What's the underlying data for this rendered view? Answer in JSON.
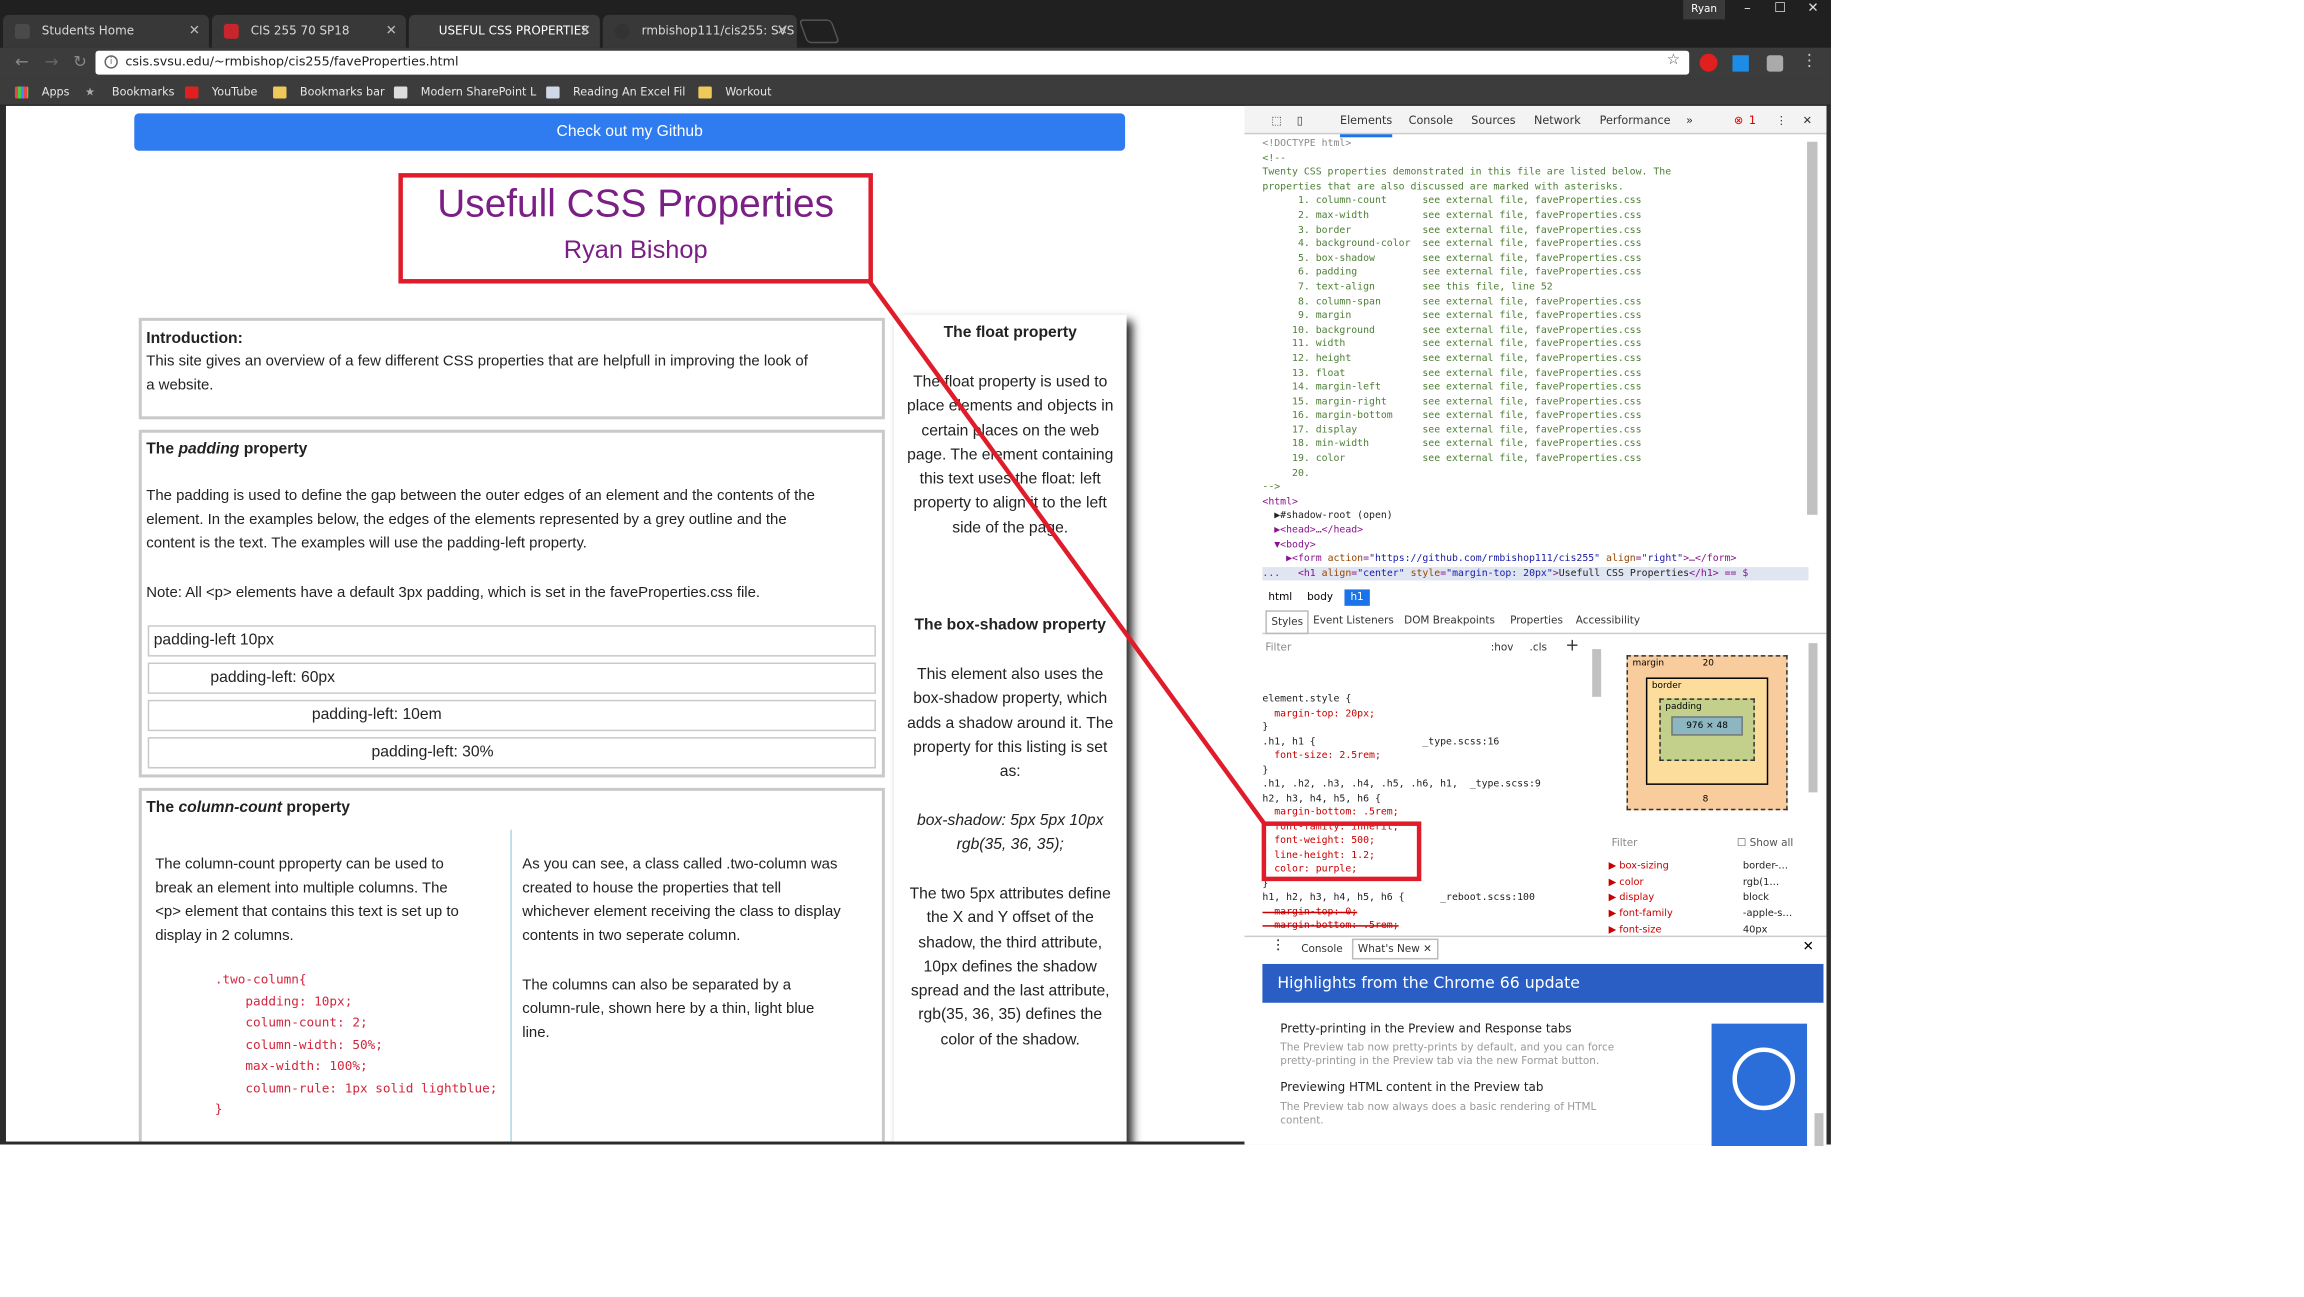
{
  "tabs": [
    {
      "label": "Students Home",
      "color": "#4a4a4a"
    },
    {
      "label": "CIS 255 70 SP18",
      "color": "#c9252c"
    },
    {
      "label": "USEFUL CSS PROPERTIES",
      "color": "#6f6f6f"
    },
    {
      "label": "rmbishop111/cis255: SVS",
      "color": "#333333"
    }
  ],
  "profile": "Ryan",
  "address": "csis.svsu.edu/~rmbishop/cis255/faveProperties.html",
  "bookmarks": [
    "Apps",
    "Bookmarks",
    "YouTube",
    "Bookmarks bar",
    "Modern SharePoint L",
    "Reading An Excel Fil",
    "Workout"
  ],
  "page": {
    "git_button": "Check out my Github",
    "title": "Usefull CSS Properties",
    "author": "Ryan Bishop",
    "intro_heading": "Introduction:",
    "intro_text_1": "This site gives an overview of a few different CSS properties that are helpfull in improving the look of",
    "intro_text_2": "a website.",
    "padding_heading_pre": "The ",
    "padding_heading_em": "padding",
    "padding_heading_post": " property",
    "padding_text_1": "The padding is used to define the gap between the outer edges of an element and the contents of the",
    "padding_text_2": "element. In the examples below, the edges of the elements represented by a grey outline and the",
    "padding_text_3": "content is the text. The examples will use the padding-left property.",
    "padding_note": "Note: All <p> elements have a default 3px padding, which is set in the faveProperties.css file.",
    "padding_examples": [
      "padding-left 10px",
      "padding-left: 60px",
      "padding-left: 10em",
      "padding-left: 30%"
    ],
    "column_heading_pre": "The ",
    "column_heading_em": "column-count",
    "column_heading_post": " property",
    "column_left": [
      "The column-count pproperty can be used to",
      "break an element into multiple columns. The",
      "<p> element that contains this text is set up to",
      "display in 2 columns."
    ],
    "column_code": [
      ".two-column{",
      "    padding: 10px;",
      "    column-count: 2;",
      "    column-width: 50%;",
      "    max-width: 100%;",
      "    column-rule: 1px solid lightblue;",
      "}"
    ],
    "column_right_1": [
      "As you can see, a class called .two-column was",
      "created to house the properties that tell",
      "whichever element receiving the class to display",
      "contents in two seperate column."
    ],
    "column_right_2": [
      "The columns can also be separated by a",
      "column-rule, shown here by a thin, light blue",
      "line."
    ],
    "float_heading": "The float property",
    "float_text": [
      "The float property is used to",
      "place elements and objects in",
      "certain places on the web",
      "page. The element containing",
      "this text uses the float: left",
      "property to align it to the left",
      "side of the page."
    ],
    "shadow_heading": "The box-shadow property",
    "shadow_text": [
      "This element also uses the",
      "box-shadow property, which",
      "adds a shadow around it. The",
      "property for this listing is set",
      "as:"
    ],
    "shadow_code": [
      "box-shadow: 5px 5px 10px",
      "rgb(35, 36, 35);"
    ],
    "shadow_text_2": [
      "The two 5px attributes define",
      "the X and Y offset of the",
      "shadow, the third attribute,",
      "10px defines the shadow",
      "spread and the last attribute,",
      "rgb(35, 36, 35) defines the",
      "color of the shadow."
    ]
  },
  "devtools": {
    "tabs": [
      "Elements",
      "Console",
      "Sources",
      "Network",
      "Performance"
    ],
    "error_count": "1",
    "comment_head": [
      "<!DOCTYPE html>",
      "<!--",
      "Twenty CSS properties demonstrated in this file are listed below. The",
      "properties that are also discussed are marked with asterisks."
    ],
    "props": [
      [
        "1.",
        "column-count",
        "see external file, faveProperties.css"
      ],
      [
        "2.",
        "max-width",
        "see external file, faveProperties.css"
      ],
      [
        "3.",
        "border",
        "see external file, faveProperties.css"
      ],
      [
        "4.",
        "background-color",
        "see external file, faveProperties.css"
      ],
      [
        "5.",
        "box-shadow",
        "see external file, faveProperties.css"
      ],
      [
        "6.",
        "padding",
        "see external file, faveProperties.css"
      ],
      [
        "7.",
        "text-align",
        "see this file, line 52"
      ],
      [
        "8.",
        "column-span",
        "see external file, faveProperties.css"
      ],
      [
        "9.",
        "margin",
        "see external file, faveProperties.css"
      ],
      [
        "10.",
        "background",
        "see external file, faveProperties.css"
      ],
      [
        "11.",
        "width",
        "see external file, faveProperties.css"
      ],
      [
        "12.",
        "height",
        "see external file, faveProperties.css"
      ],
      [
        "13.",
        "float",
        "see external file, faveProperties.css"
      ],
      [
        "14.",
        "margin-left",
        "see external file, faveProperties.css"
      ],
      [
        "15.",
        "margin-right",
        "see external file, faveProperties.css"
      ],
      [
        "16.",
        "margin-bottom",
        "see external file, faveProperties.css"
      ],
      [
        "17.",
        "display",
        "see external file, faveProperties.css"
      ],
      [
        "18.",
        "min-width",
        "see external file, faveProperties.css"
      ],
      [
        "19.",
        "color",
        "see external file, faveProperties.css"
      ],
      [
        "20.",
        "",
        ""
      ]
    ],
    "comment_end": "-->",
    "crumbs": [
      "html",
      "body",
      "h1"
    ],
    "subtabs": [
      "Styles",
      "Event Listeners",
      "DOM Breakpoints",
      "Properties",
      "Accessibility"
    ],
    "filter": "Filter",
    "hov": ":hov",
    "cls": ".cls",
    "styles_lines": [
      "element.style {",
      "  margin-top: 20px;",
      "}",
      "",
      ".h1, h1 {                  _type.scss:16",
      "  font-size: 2.5rem;",
      "}",
      "",
      ".h1, .h2, .h3, .h4, .h5, .h6, h1,  _type.scss:9",
      "h2, h3, h4, h5, h6 {",
      "  margin-bottom: .5rem;",
      "  font-family: inherit;",
      "  font-weight: 500;",
      "  line-height: 1.2;",
      "  color: purple;",
      "}",
      "",
      "h1, h2, h3, h4, h5, h6 {      _reboot.scss:100",
      "  margin-top: 0;",
      "  margin-bottom: .5rem;"
    ],
    "box": {
      "margin_label": "margin",
      "margin": "20",
      "border_label": "border",
      "border": "–",
      "padding_label": "padding",
      "padding": "–",
      "content": "976 × 48",
      "bottom": "8"
    },
    "computed_filter": "Filter",
    "show_all": "Show all",
    "computed": [
      [
        "box-sizing",
        "border-…"
      ],
      [
        "color",
        "rgb(1…"
      ],
      [
        "display",
        "block"
      ],
      [
        "font-family",
        "-apple-s…"
      ],
      [
        "font-size",
        "40px"
      ]
    ],
    "drawer_tabs": [
      "Console",
      "What's New"
    ],
    "whats_new_title": "Highlights from the Chrome 66 update",
    "news": [
      {
        "title": "Pretty-printing in the Preview and Response tabs",
        "desc_1": "The Preview tab now pretty-prints by default, and you can force",
        "desc_2": "pretty-printing in the Preview tab via the new Format button."
      },
      {
        "title": "Previewing HTML content in the Preview tab",
        "desc_1": "The Preview tab now always does a basic rendering of HTML",
        "desc_2": "content."
      }
    ]
  },
  "colors": {
    "accent": "#2f7bf0",
    "title": "#7b1e85",
    "annotation": "#e01c2b"
  }
}
